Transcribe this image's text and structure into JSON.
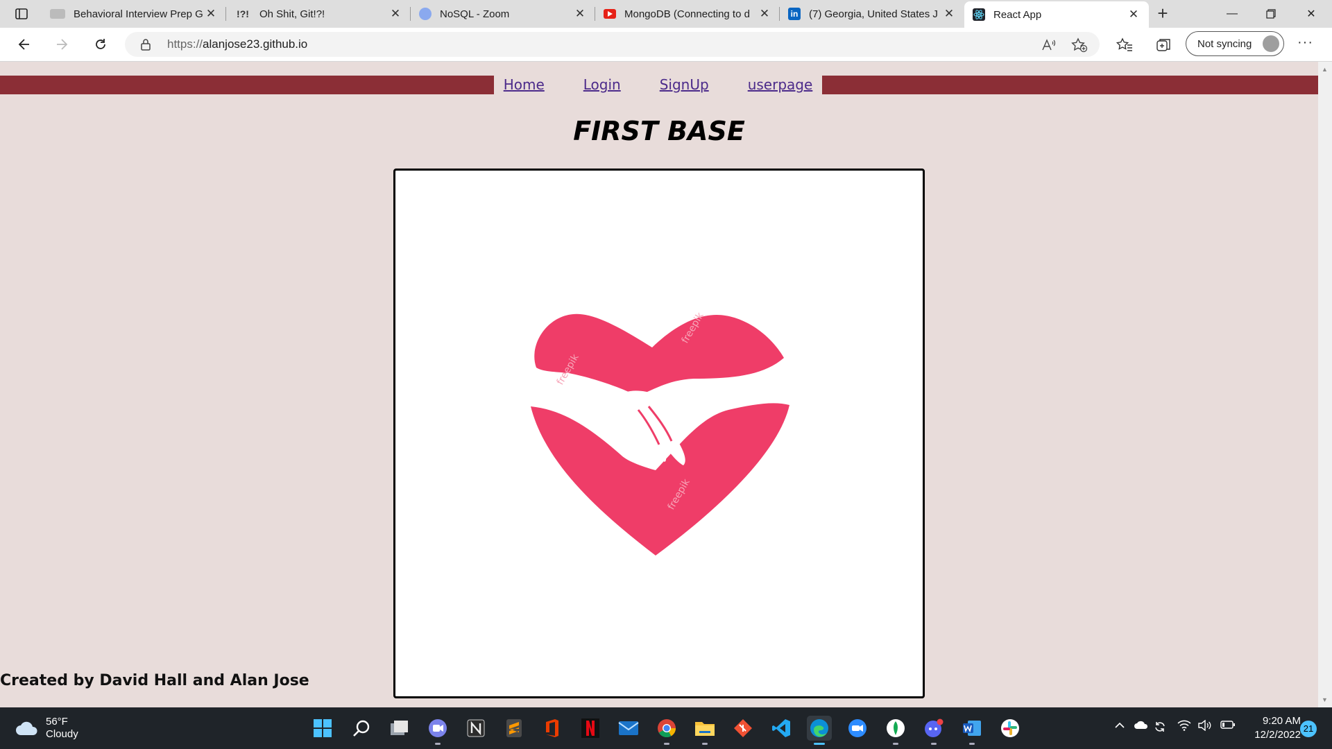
{
  "browser": {
    "tabs": [
      {
        "title": "Behavioral Interview Prep G",
        "favicon": "book-icon",
        "favicon_text": ""
      },
      {
        "title": "Oh Shit, Git!?!",
        "favicon": "git-icon",
        "favicon_text": "!?!"
      },
      {
        "title": "NoSQL - Zoom",
        "favicon": "zoom-icon",
        "favicon_text": ""
      },
      {
        "title": "MongoDB (Connecting to d",
        "favicon": "youtube-icon",
        "favicon_text": ""
      },
      {
        "title": "(7) Georgia, United States J",
        "favicon": "linkedin-icon",
        "favicon_text": "in"
      },
      {
        "title": "React App",
        "favicon": "react-icon",
        "favicon_text": ""
      }
    ],
    "url_protocol": "https://",
    "url_host": "alanjose23.github.io",
    "sync_label": "Not syncing"
  },
  "page": {
    "nav_links": [
      "Home",
      "Login",
      "SignUp",
      "userpage"
    ],
    "title": "FIRST BASE",
    "credit": "Created by David Hall and Alan Jose",
    "image_watermark": "freepik"
  },
  "colors": {
    "nav_band": "#8b2e36",
    "page_bg": "#e8dcda",
    "heart": "#ef3d68",
    "link": "#4b2a8a"
  },
  "taskbar": {
    "weather_temp": "56°F",
    "weather_desc": "Cloudy",
    "time": "9:20 AM",
    "date": "12/2/2022",
    "notifications": "21",
    "apps": [
      "start-icon",
      "search-icon",
      "task-view-icon",
      "teams-chat-icon",
      "notion-icon",
      "sublime-icon",
      "office-icon",
      "netflix-icon",
      "mail-icon",
      "chrome-icon",
      "file-explorer-icon",
      "git-icon",
      "vscode-icon",
      "edge-icon",
      "zoom-icon",
      "mongodb-compass-icon",
      "discord-icon",
      "word-icon",
      "slack-icon"
    ]
  }
}
